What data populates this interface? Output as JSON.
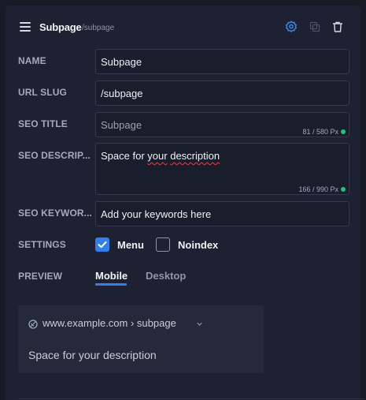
{
  "header": {
    "title": "Subpage",
    "slug": "/subpage",
    "icons": [
      "menu-icon",
      "gear-icon",
      "duplicate-icon",
      "trash-icon"
    ]
  },
  "fields": {
    "name": {
      "label": "NAME",
      "value": "Subpage"
    },
    "url_slug": {
      "label": "URL SLUG",
      "value": "/subpage"
    },
    "seo_title": {
      "label": "SEO TITLE",
      "placeholder": "Subpage",
      "counter": "81 / 580 Px"
    },
    "seo_description": {
      "label": "SEO DESCRIP...",
      "value": "Space for your description",
      "counter": "166 / 990 Px"
    },
    "seo_keywords": {
      "label": "SEO KEYWOR...",
      "placeholder": "Add your keywords here"
    }
  },
  "settings": {
    "label": "SETTINGS",
    "options": [
      {
        "label": "Menu",
        "checked": true
      },
      {
        "label": "Noindex",
        "checked": false
      }
    ]
  },
  "preview": {
    "label": "PREVIEW",
    "tabs": [
      {
        "label": "Mobile",
        "active": true
      },
      {
        "label": "Desktop",
        "active": false
      }
    ],
    "card": {
      "url": "www.example.com › subpage",
      "description": "Space for your description"
    }
  },
  "colors": {
    "accent": "#2f80ed",
    "ok": "#21c47a",
    "background": "#1d2131"
  }
}
